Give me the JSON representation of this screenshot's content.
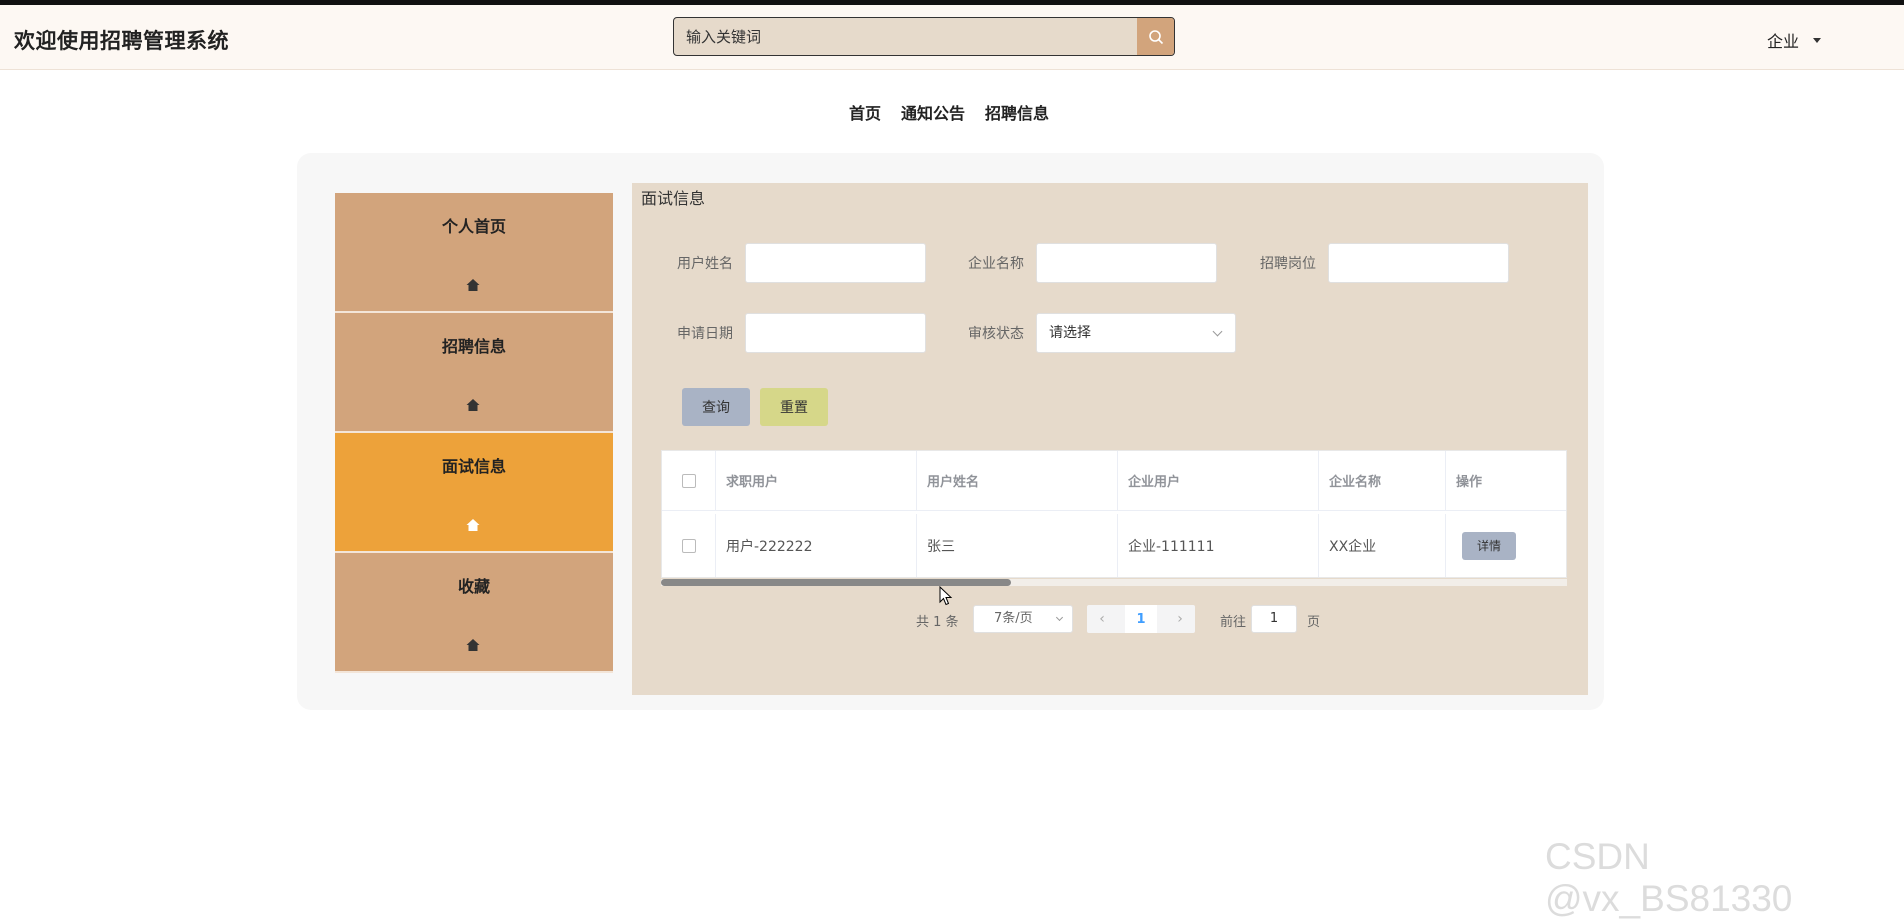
{
  "header": {
    "app_title": "欢迎使用招聘管理系统",
    "search_placeholder": "输入关键词",
    "user_label": "企业"
  },
  "nav": {
    "items": [
      "首页",
      "通知公告",
      "招聘信息"
    ]
  },
  "sidebar": {
    "items": [
      {
        "label": "个人首页",
        "icon": "home-icon"
      },
      {
        "label": "招聘信息",
        "icon": "home-icon"
      },
      {
        "label": "面试信息",
        "icon": "home-icon",
        "active": true
      },
      {
        "label": "收藏",
        "icon": "home-icon"
      }
    ]
  },
  "content": {
    "title": "面试信息",
    "form": {
      "username_label": "用户姓名",
      "company_name_label": "企业名称",
      "position_label": "招聘岗位",
      "apply_date_label": "申请日期",
      "review_status_label": "审核状态",
      "review_status_value": "请选择"
    },
    "buttons": {
      "query": "查询",
      "reset": "重置"
    },
    "table": {
      "headers": [
        "求职用户",
        "用户姓名",
        "企业用户",
        "企业名称",
        "操作"
      ],
      "rows": [
        {
          "job_user": "用户-222222",
          "username": "张三",
          "company_user": "企业-111111",
          "company_name": "XX企业",
          "action": "详情"
        }
      ]
    },
    "pagination": {
      "total": "共 1 条",
      "page_size": "7条/页",
      "current_page": "1",
      "goto_label": "前往",
      "goto_value": "1",
      "goto_suffix": "页"
    }
  },
  "watermark": "CSDN @vx_BS81330",
  "colors": {
    "sidebar": "#d2a47c",
    "sidebar_active": "#eda23a",
    "content_bg": "#e6dacb",
    "query_button": "#a9b3c5",
    "reset_button": "#d6d789"
  }
}
